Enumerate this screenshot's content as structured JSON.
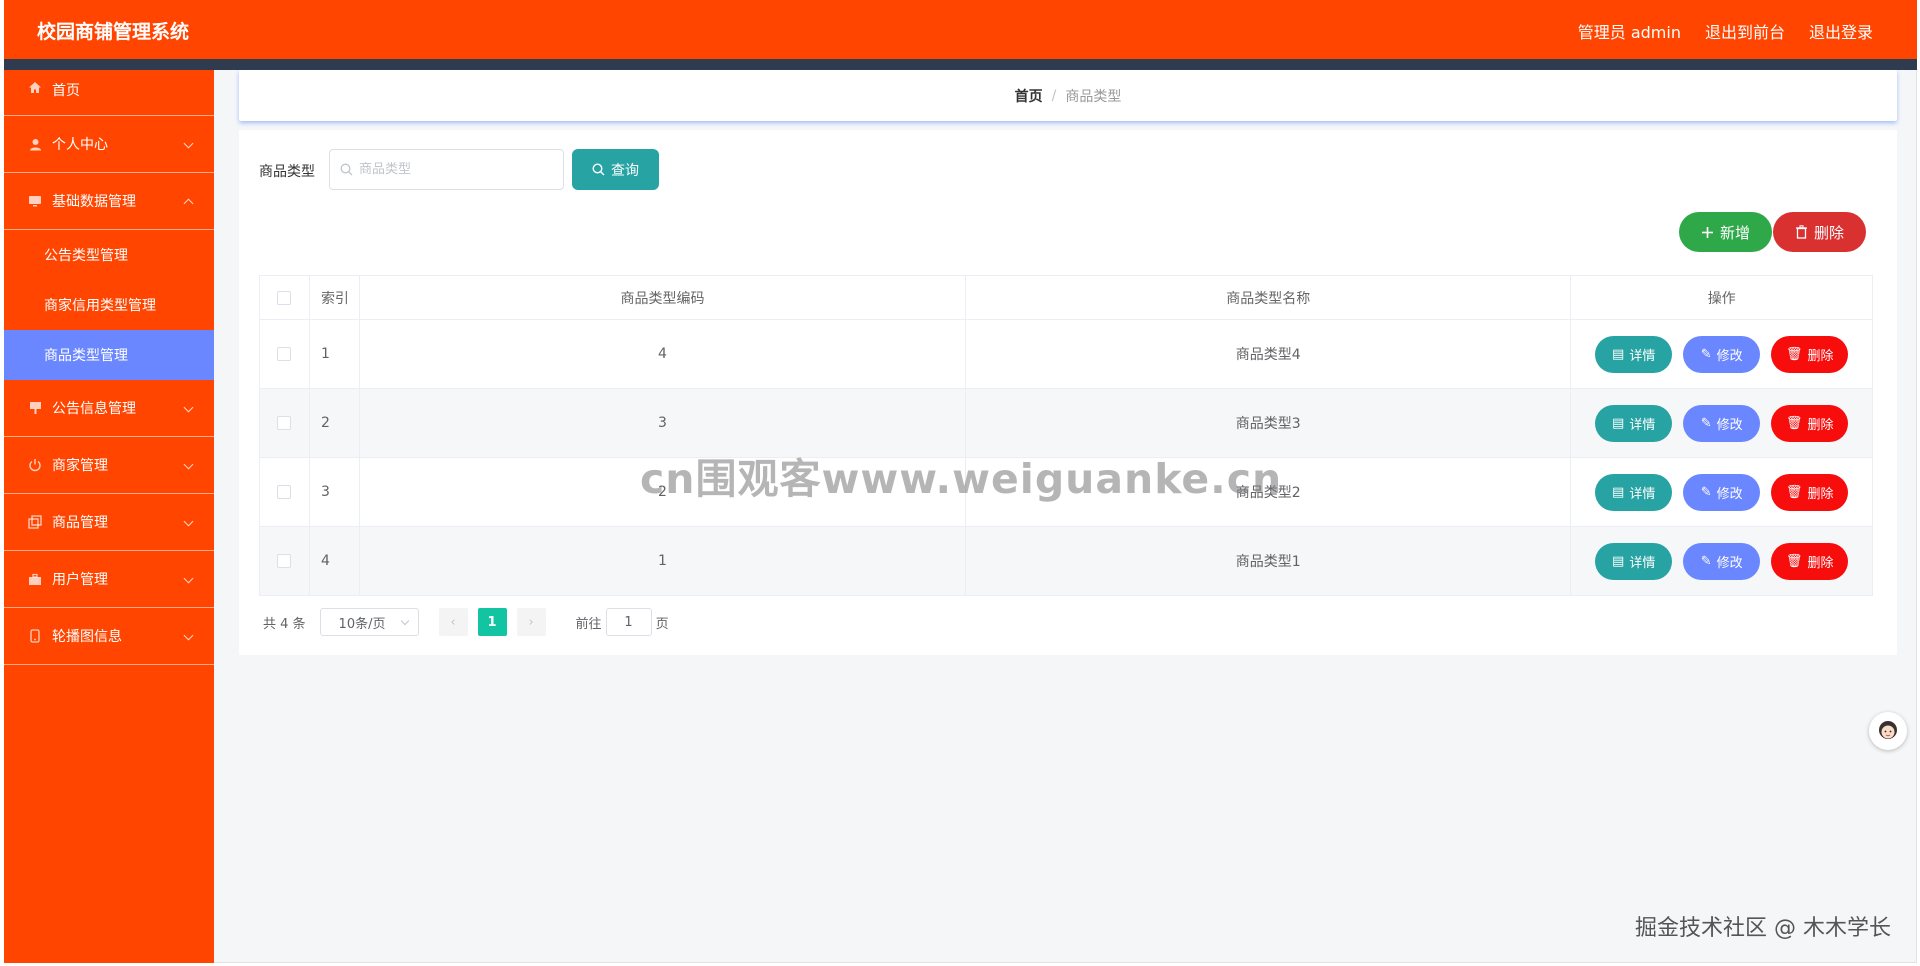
{
  "header": {
    "title": "校园商铺管理系统",
    "admin_label": "管理员 admin",
    "front_link": "退出到前台",
    "logout_link": "退出登录"
  },
  "sidebar": {
    "items": [
      {
        "label": "首页",
        "icon": "home-icon"
      },
      {
        "label": "个人中心",
        "icon": "user-icon"
      },
      {
        "label": "基础数据管理",
        "icon": "monitor-icon",
        "expanded": true,
        "children": [
          {
            "label": "公告类型管理"
          },
          {
            "label": "商家信用类型管理"
          },
          {
            "label": "商品类型管理",
            "active": true
          }
        ]
      },
      {
        "label": "公告信息管理",
        "icon": "board-icon"
      },
      {
        "label": "商家管理",
        "icon": "power-icon"
      },
      {
        "label": "商品管理",
        "icon": "copy-icon"
      },
      {
        "label": "用户管理",
        "icon": "briefcase-icon"
      },
      {
        "label": "轮播图信息",
        "icon": "phone-icon"
      }
    ]
  },
  "breadcrumb": {
    "home": "首页",
    "separator": "/",
    "current": "商品类型"
  },
  "search": {
    "label": "商品类型",
    "placeholder": "商品类型",
    "value": "",
    "button": "查询"
  },
  "actions": {
    "add": "新增",
    "delete": "删除"
  },
  "table": {
    "headers": [
      "索引",
      "商品类型编码",
      "商品类型名称",
      "操作"
    ],
    "rows": [
      {
        "index": "1",
        "code": "4",
        "name": "商品类型4"
      },
      {
        "index": "2",
        "code": "3",
        "name": "商品类型3"
      },
      {
        "index": "3",
        "code": "2",
        "name": "商品类型2"
      },
      {
        "index": "4",
        "code": "1",
        "name": "商品类型1"
      }
    ],
    "row_actions": {
      "detail": "详情",
      "edit": "修改",
      "delete": "删除"
    }
  },
  "pagination": {
    "total": "共 4 条",
    "page_size": "10条/页",
    "current_page": "1",
    "goto_prefix": "前往",
    "goto_value": "1",
    "goto_suffix": "页"
  },
  "watermark": "cn围观客www.weiguanke.cn",
  "footer_mark": "掘金技术社区 @ 木木学长",
  "colors": {
    "primary": "#ff4500",
    "strip": "#2f3b4f",
    "active_sub": "#6b87ff",
    "teal": "#27a3a3",
    "green": "#2fa84a",
    "red": "#d93030",
    "page_active": "#13c4a3"
  }
}
